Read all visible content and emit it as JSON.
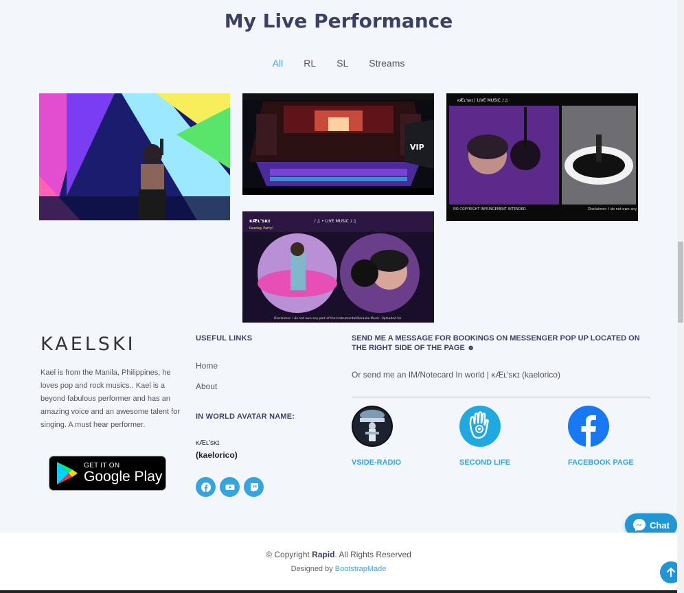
{
  "portfolio": {
    "title": "My Live Performance",
    "filters": [
      "All",
      "RL",
      "SL",
      "Streams"
    ],
    "active_filter": "All"
  },
  "footer": {
    "brand": "KAELSKI",
    "about": "Kael is from the Manila, Philippines, he loves pop and rock musics.. Kael is a beyond fabulous performer and has an amazing voice and an awesome talent for singing. A must hear performer.",
    "google_play": {
      "small": "GET IT ON",
      "big": "Google Play"
    },
    "useful_links": {
      "heading": "USEFUL LINKS",
      "items": [
        "Home",
        "About"
      ]
    },
    "avatar": {
      "heading": "IN WORLD AVATAR NAME:",
      "name": "ĸÆʟ'sĸɪ",
      "id": "(kaelorico)"
    },
    "socials": [
      "facebook-icon",
      "youtube-icon",
      "twitch-icon"
    ],
    "message": {
      "heading": "SEND ME A MESSAGE FOR BOOKINGS ON MESSENGER POP UP LOCATED ON THE RIGHT SIDE OF THE PAGE ☻",
      "sub": "Or send me an IM/Notecard In world | ĸÆʟ'sĸɪ (kaelorico)"
    },
    "external_links": [
      {
        "label": "VSIDE-RADIO",
        "icon": "vside-radio-icon"
      },
      {
        "label": "SECOND LIFE",
        "icon": "second-life-hand-icon"
      },
      {
        "label": "FACEBOOK PAGE",
        "icon": "facebook-icon"
      }
    ]
  },
  "chat": {
    "label": "Chat"
  },
  "copyright": {
    "prefix": "© Copyright ",
    "brand": "Rapid",
    "suffix": ". All Rights Reserved",
    "designed_prefix": "Designed by ",
    "designed_link": "BootstrapMade"
  },
  "thumbnails": {
    "card3_header": "ĸÆʟ'sĸɪ | LIVE MUSIC ♪♫",
    "card3_footer_left": "NO COPYRIGHT INFRINGEMENT INTENDED.",
    "card3_footer_right": "Disclaimer: I do not own any",
    "card4_header": "ĸÆʟ'sĸɪ",
    "card4_sub": "Reeday Party!",
    "card4_mid": "♪♫ • LIVE MUSIC ♪♫",
    "card4_footer": "Disclaimer: I do not own any part of the Instrumental/Karaoke Music. Uploaded for",
    "card2_badge": "VIP"
  },
  "colors": {
    "accent": "#35a6dd",
    "heading": "#3d4066",
    "background": "#f3f6fb"
  }
}
